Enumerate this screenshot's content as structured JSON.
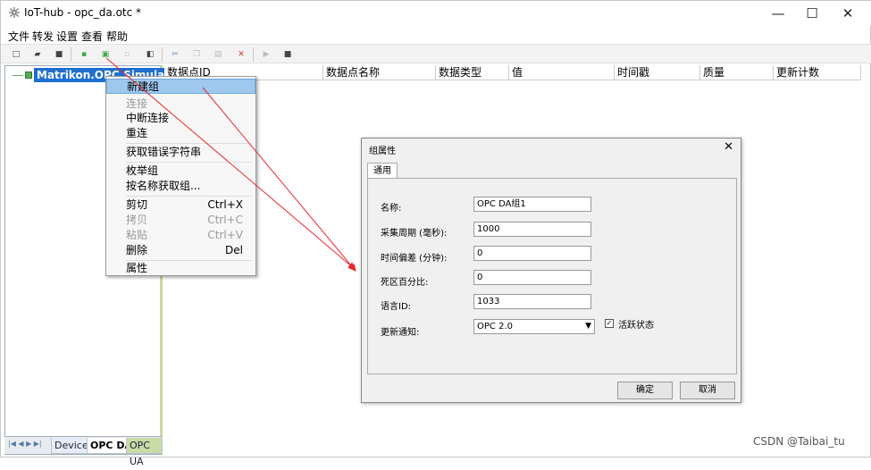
{
  "window": {
    "title": "IoT-hub - opc_da.otc *",
    "controls": [
      "—",
      "☐",
      "✕"
    ]
  },
  "menu": [
    "文件",
    "转发",
    "设置",
    "查看",
    "帮助"
  ],
  "toolbar_icons": [
    "new-icon",
    "open-icon",
    "save-icon",
    "add-server-icon",
    "add-group-icon",
    "add-item-icon",
    "properties-icon",
    "cut-icon",
    "copy-icon",
    "paste-icon",
    "delete-icon",
    "play-icon",
    "stop-icon"
  ],
  "tree": {
    "root_label": "Matrikon.OPC.Simulation"
  },
  "tabs": {
    "nav_glyphs": "|◀ ◀ ▶ ▶|",
    "device": "Device",
    "opc_da": "OPC DA",
    "opc_ua": "OPC UA"
  },
  "list_columns": [
    "数据点ID",
    "数据点名称",
    "数据类型",
    "值",
    "时间戳",
    "质量",
    "更新计数"
  ],
  "context_menu": {
    "items": [
      {
        "label": "新建组",
        "shortcut": "",
        "highlighted": true,
        "disabled": false
      },
      {
        "label": "连接",
        "shortcut": "",
        "highlighted": false,
        "disabled": true
      },
      {
        "label": "中断连接",
        "shortcut": "",
        "highlighted": false,
        "disabled": false
      },
      {
        "label": "重连",
        "shortcut": "",
        "highlighted": false,
        "disabled": false
      },
      {
        "label": "获取错误字符串",
        "shortcut": "",
        "highlighted": false,
        "disabled": false
      },
      {
        "label": "枚举组",
        "shortcut": "",
        "highlighted": false,
        "disabled": false
      },
      {
        "label": "按名称获取组...",
        "shortcut": "",
        "highlighted": false,
        "disabled": false
      },
      {
        "label": "剪切",
        "shortcut": "Ctrl+X",
        "highlighted": false,
        "disabled": false
      },
      {
        "label": "拷贝",
        "shortcut": "Ctrl+C",
        "highlighted": false,
        "disabled": true
      },
      {
        "label": "粘贴",
        "shortcut": "Ctrl+V",
        "highlighted": false,
        "disabled": true
      },
      {
        "label": "删除",
        "shortcut": "Del",
        "highlighted": false,
        "disabled": false
      },
      {
        "label": "属性",
        "shortcut": "",
        "highlighted": false,
        "disabled": false
      }
    ]
  },
  "dialog": {
    "title": "组属性",
    "tab": "通用",
    "fields": [
      {
        "label": "名称:",
        "value": "OPC DA组1"
      },
      {
        "label": "采集周期 (毫秒):",
        "value": "1000"
      },
      {
        "label": "时间偏差 (分钟):",
        "value": "0"
      },
      {
        "label": "死区百分比:",
        "value": "0"
      },
      {
        "label": "语言ID:",
        "value": "1033"
      }
    ],
    "update_label": "更新通知:",
    "update_value": "OPC 2.0",
    "active_checked": true,
    "active_label": "活跃状态",
    "ok": "确定",
    "cancel": "取消"
  },
  "annotation_color": "#e8282b",
  "watermark": "CSDN @Taibai_tu"
}
